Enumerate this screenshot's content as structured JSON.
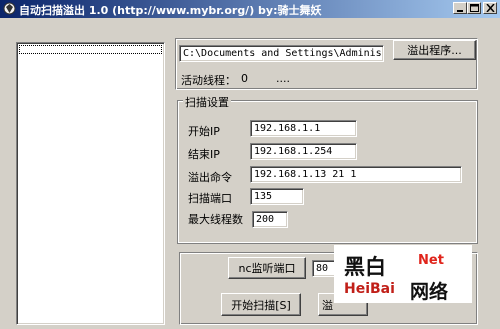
{
  "window": {
    "title": "自动扫描溢出 1.0 (http://www.mybr.org/)  by:骑士舞妖",
    "controls": [
      "minimize",
      "maximize",
      "close"
    ]
  },
  "path_field": {
    "value": "C:\\Documents and Settings\\Adminis"
  },
  "overflow_program_button": {
    "label": "溢出程序..."
  },
  "active_threads": {
    "label": "活动线程：",
    "value": "0",
    "dots": "...."
  },
  "scan_settings": {
    "group_label": "扫描设置",
    "start_ip": {
      "label": "开始IP",
      "value": "192.168.1.1"
    },
    "end_ip": {
      "label": "结束IP",
      "value": "192.168.1.254"
    },
    "overflow_command": {
      "label": "溢出命令",
      "value": "192.168.1.13 21 1"
    },
    "scan_port": {
      "label": "扫描端口",
      "value": "135"
    },
    "max_threads": {
      "label": "最大线程数",
      "value": "200"
    }
  },
  "nc_listen_button": {
    "label": "nc监听端口"
  },
  "nc_port_field": {
    "value": "80"
  },
  "start_scan_button": {
    "label": "开始扫描[S]"
  },
  "partial_button": {
    "label": "溢"
  },
  "watermark": {
    "line1": "黑白",
    "net": "Net",
    "heibai": "HeiBai",
    "wangluo": "网络"
  }
}
